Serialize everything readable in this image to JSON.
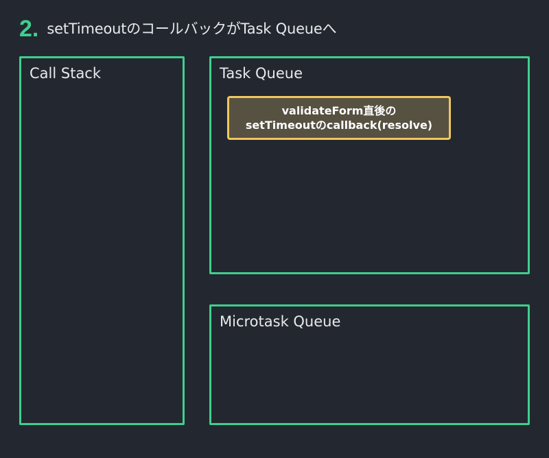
{
  "header": {
    "step_number": "2.",
    "title": "setTimeoutのコールバックがTask Queueへ"
  },
  "panels": {
    "call_stack": {
      "title": "Call Stack"
    },
    "task_queue": {
      "title": "Task Queue",
      "items": [
        {
          "line1": "validateForm直後の",
          "line2": "setTimeoutのcallback(resolve)"
        }
      ]
    },
    "microtask_queue": {
      "title": "Microtask Queue"
    }
  },
  "colors": {
    "background": "#232830",
    "panel_border": "#3fcf8e",
    "step_number": "#3fcf8e",
    "item_border": "#f0c860",
    "item_fill": "#575142",
    "text": "#e8eaed"
  }
}
